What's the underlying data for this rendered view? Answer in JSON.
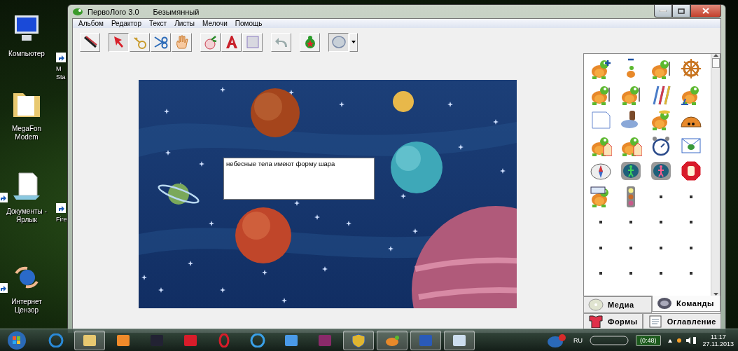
{
  "desktop_icons": [
    {
      "kind": "computer",
      "label": "Компьютер",
      "shortcut": false
    },
    {
      "kind": "folder",
      "label": "MegaFon Modem",
      "shortcut": false
    },
    {
      "kind": "documents",
      "label": "Документы - Ярлык",
      "shortcut": true
    },
    {
      "kind": "censor",
      "label": "Интернет Цензор",
      "shortcut": true
    }
  ],
  "hidden_icons": [
    {
      "lines": [
        "M",
        "Sta"
      ]
    },
    {
      "lines": [
        "Fire"
      ]
    }
  ],
  "window": {
    "title": "ПервоЛого 3.0",
    "document": "Безымянный"
  },
  "menu": [
    "Альбом",
    "Редактор",
    "Текст",
    "Листы",
    "Мелочи",
    "Помощь"
  ],
  "toolbar": [
    [
      {
        "kind": "brushes",
        "selected": false
      }
    ],
    [
      {
        "kind": "arrow",
        "selected": true
      },
      {
        "kind": "key",
        "selected": false
      },
      {
        "kind": "scissors",
        "selected": false
      },
      {
        "kind": "hand",
        "selected": false
      }
    ],
    [
      {
        "kind": "radish",
        "selected": false
      },
      {
        "kind": "letter",
        "selected": false
      },
      {
        "kind": "square",
        "selected": false
      }
    ],
    [
      {
        "kind": "undo",
        "selected": false
      }
    ],
    [
      {
        "kind": "turtle",
        "selected": false
      }
    ],
    [
      {
        "kind": "ellipse",
        "selected": true
      }
    ]
  ],
  "canvas": {
    "text_box": "небесные тела имеют форму шара"
  },
  "palette": [
    {
      "kind": "turtle-plus"
    },
    {
      "kind": "turtle-minus"
    },
    {
      "kind": "turtle-walk"
    },
    {
      "kind": "wheel"
    },
    {
      "kind": "turtle-pen"
    },
    {
      "kind": "turtle-brush"
    },
    {
      "kind": "pencils"
    },
    {
      "kind": "turtle-water"
    },
    {
      "kind": "page"
    },
    {
      "kind": "stamp"
    },
    {
      "kind": "turtle-hat"
    },
    {
      "kind": "shell"
    },
    {
      "kind": "turtle-house"
    },
    {
      "kind": "turtle-house"
    },
    {
      "kind": "alarm-clock"
    },
    {
      "kind": "envelope"
    },
    {
      "kind": "compass"
    },
    {
      "kind": "green-walker"
    },
    {
      "kind": "red-walker"
    },
    {
      "kind": "stop-hand"
    },
    {
      "kind": "turtle-sign"
    },
    {
      "kind": "traffic-light"
    },
    {
      "kind": "empty"
    },
    {
      "kind": "empty"
    },
    {
      "kind": "empty"
    },
    {
      "kind": "empty"
    },
    {
      "kind": "empty"
    },
    {
      "kind": "empty"
    },
    {
      "kind": "empty"
    },
    {
      "kind": "empty"
    },
    {
      "kind": "empty"
    },
    {
      "kind": "empty"
    },
    {
      "kind": "empty"
    },
    {
      "kind": "empty"
    },
    {
      "kind": "empty"
    },
    {
      "kind": "empty"
    },
    {
      "kind": "empty"
    },
    {
      "kind": "empty"
    },
    {
      "kind": "empty"
    },
    {
      "kind": "empty"
    }
  ],
  "tabs": [
    [
      {
        "kind": "disc",
        "label": "Медиа",
        "selected": false
      },
      {
        "kind": "commands",
        "label": "Команды",
        "selected": true
      }
    ],
    [
      {
        "kind": "shirt",
        "label": "Формы",
        "selected": false
      },
      {
        "kind": "contents",
        "label": "Оглавление",
        "selected": false
      }
    ]
  ],
  "taskbar": {
    "apps": [
      {
        "kind": "ie",
        "running": false
      },
      {
        "kind": "folder",
        "running": true
      },
      {
        "kind": "player",
        "running": false
      },
      {
        "kind": "scanner",
        "running": false
      },
      {
        "kind": "antivirus",
        "running": false
      },
      {
        "kind": "opera",
        "running": false
      },
      {
        "kind": "ie2",
        "running": false
      },
      {
        "kind": "mail",
        "running": false
      },
      {
        "kind": "archive",
        "running": false
      },
      {
        "kind": "shield",
        "running": true
      },
      {
        "kind": "turtle",
        "running": true
      },
      {
        "kind": "word",
        "running": true
      },
      {
        "kind": "windows",
        "running": true
      }
    ],
    "language": "RU",
    "battery": "(0:48)",
    "time": "11:17",
    "date": "27.11.2013"
  }
}
